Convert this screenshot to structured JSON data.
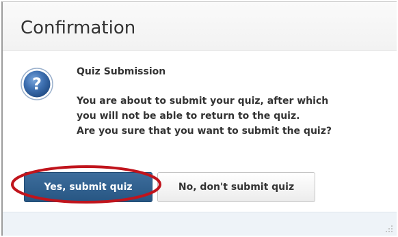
{
  "dialog": {
    "title": "Confirmation",
    "icon": "question-mark-icon",
    "message_heading": "Quiz Submission",
    "message_lines": [
      "You are about to submit your quiz, after which",
      "you will not be able to return to the quiz.",
      "Are you sure that you want to submit the quiz?"
    ],
    "buttons": {
      "confirm_label": "Yes, submit quiz",
      "cancel_label": "No, don't submit quiz"
    }
  },
  "colors": {
    "primary_button": "#2f5f8f",
    "highlight_ring": "#c0141c",
    "icon_blue": "#3d6fb0",
    "footer": "#eef3f8"
  }
}
